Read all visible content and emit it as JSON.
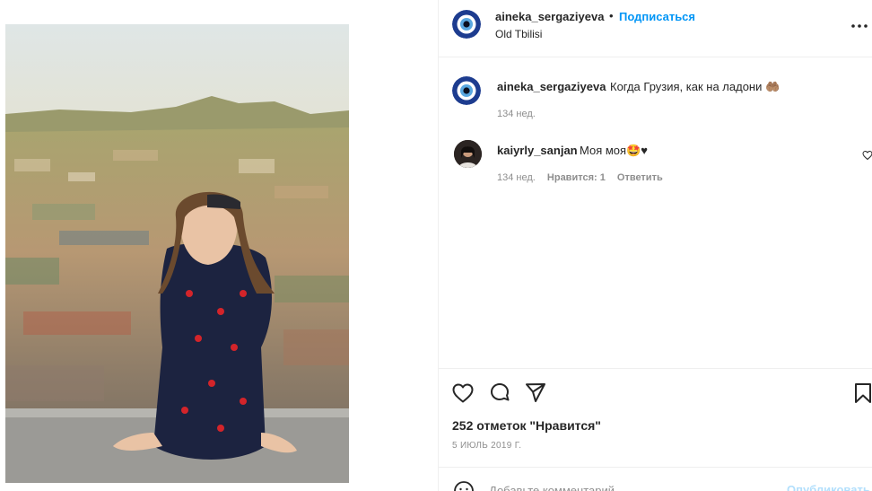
{
  "post": {
    "username": "aineka_sergaziyeva",
    "dot": "•",
    "follow_label": "Подписаться",
    "location": "Old Tbilisi",
    "more_label": "•••",
    "caption_text": "Когда Грузия, как на ладони 🤲🏽",
    "caption_time": "134 нед.",
    "likes": "252 отметок \"Нравится\"",
    "date": "5 ИЮЛЬ 2019 Г."
  },
  "comments": [
    {
      "username": "kaiyrly_sanjan",
      "text": "Моя моя🤩♥",
      "time": "134 нед.",
      "likes": "Нравится: 1",
      "reply": "Ответить"
    }
  ],
  "composer": {
    "placeholder": "Добавьте комментарий...",
    "publish_label": "Опубликовать"
  },
  "icons": {
    "like": "heart-icon",
    "comment": "comment-icon",
    "share": "paper-plane-icon",
    "save": "bookmark-icon",
    "emoji": "smiley-icon",
    "more": "more-dots-icon"
  },
  "colors": {
    "link_blue": "#0095f6",
    "muted_text": "#8e8e8e",
    "primary_text": "#262626",
    "divider": "#efefef",
    "publish_disabled": "#b2dffc"
  }
}
